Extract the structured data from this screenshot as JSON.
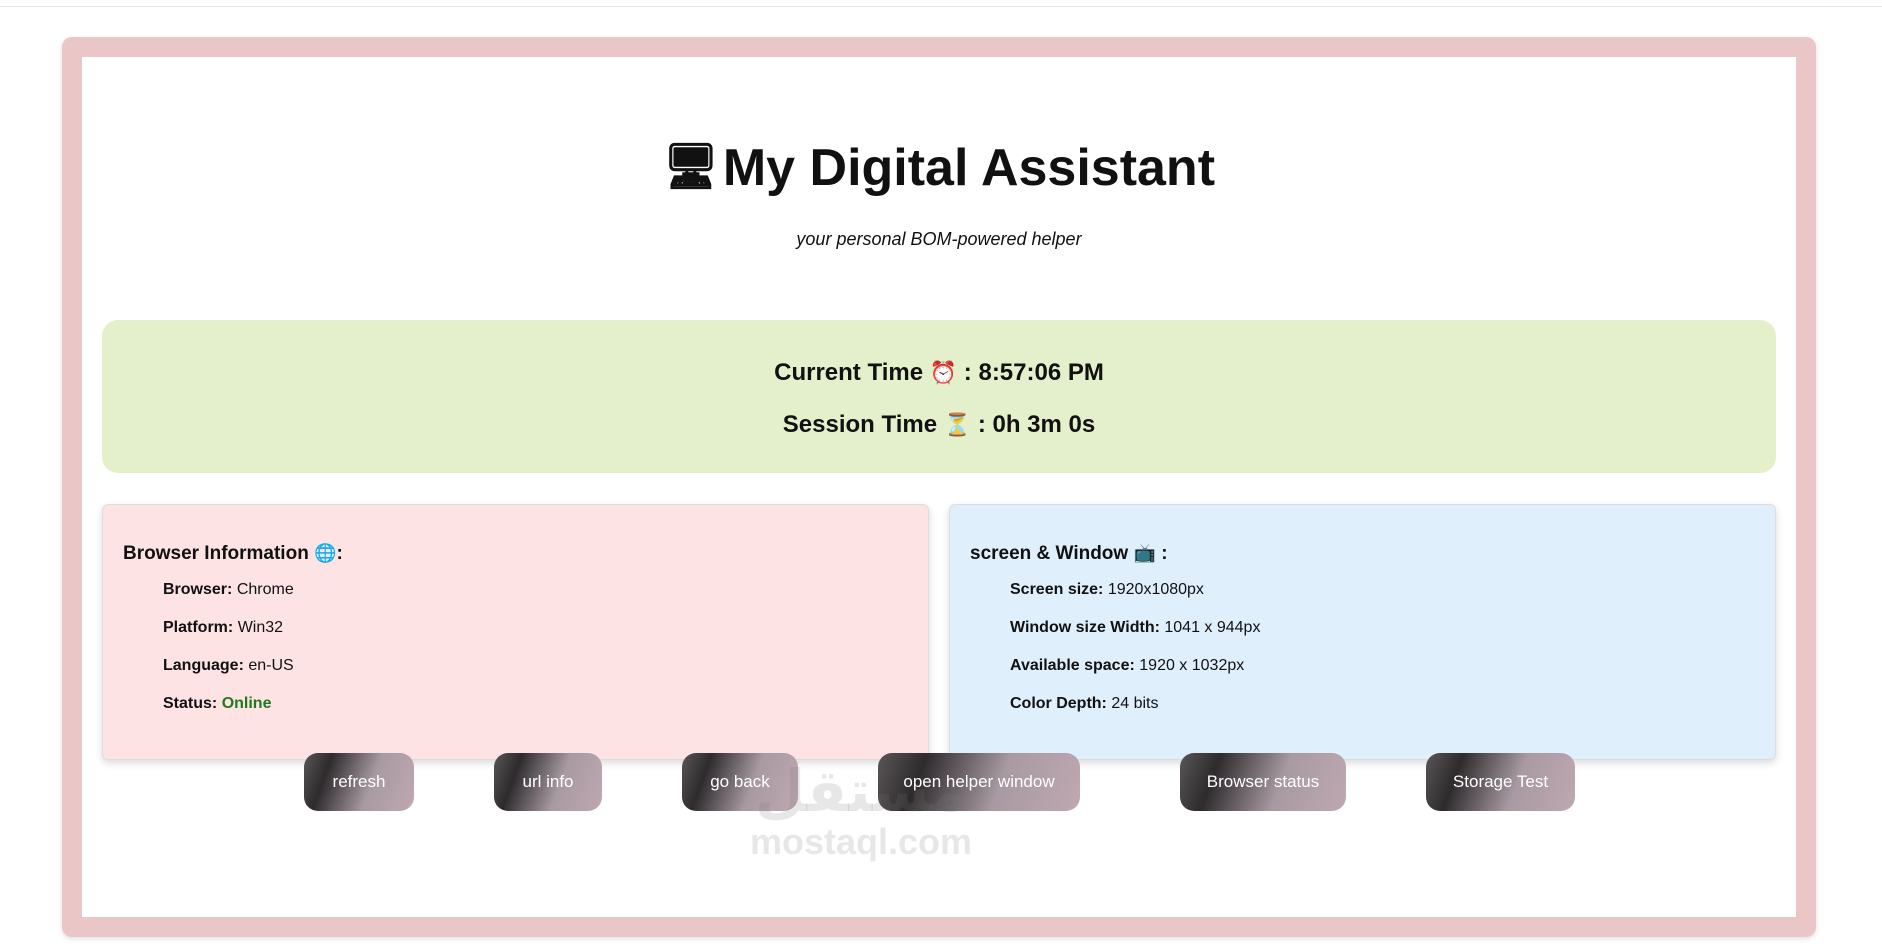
{
  "header": {
    "title_icon": "🖥",
    "title": "My Digital Assistant",
    "subtitle": "your personal BOM-powered helper"
  },
  "time": {
    "current_label": "Current Time",
    "current_emoji": "⏰",
    "current_value": "8:57:06 PM",
    "session_label": "Session Time",
    "session_emoji": "⏳",
    "session_value": "0h 3m 0s"
  },
  "browser_card": {
    "title": "Browser Information",
    "emoji": "🌐",
    "rows": [
      {
        "key": "Browser:",
        "value": "Chrome"
      },
      {
        "key": "Platform:",
        "value": "Win32"
      },
      {
        "key": "Language:",
        "value": "en-US"
      },
      {
        "key": "Status:",
        "value": "Online"
      }
    ]
  },
  "screen_card": {
    "title": "screen & Window",
    "emoji": "📺",
    "rows": [
      {
        "key": "Screen size:",
        "value": "1920x1080px"
      },
      {
        "key": "Window size Width:",
        "value": "1041 x 944px"
      },
      {
        "key": "Available space:",
        "value": "1920 x 1032px"
      },
      {
        "key": "Color Depth:",
        "value": "24 bits"
      }
    ]
  },
  "buttons": {
    "refresh": "refresh",
    "url_info": "url info",
    "go_back": "go back",
    "open_helper": "open helper window",
    "browser_status": "Browser status",
    "storage_test": "Storage Test"
  },
  "watermark": {
    "arabic": "مستقل",
    "latin": "mostaql.com"
  },
  "colors": {
    "frame": "#eac6c7",
    "time_panel": "#e3f0cb",
    "browser_card": "#fde3e4",
    "screen_card": "#e0effc",
    "online": "#1e7a1e"
  }
}
